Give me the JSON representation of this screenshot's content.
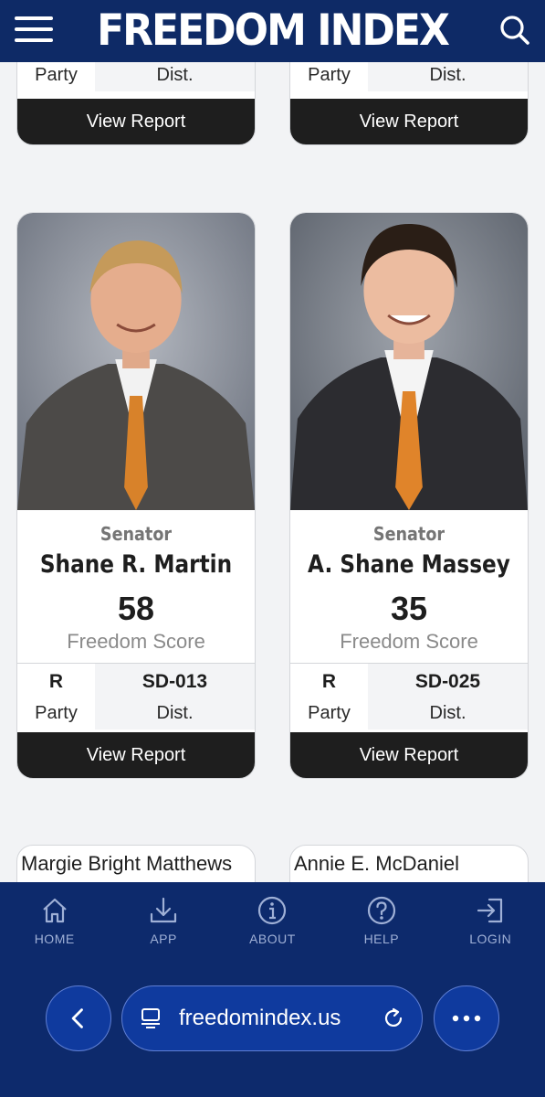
{
  "header": {
    "logo": "FREEDOM INDEX",
    "menu_icon": "hamburger-menu-icon",
    "search_icon": "search-icon"
  },
  "top_cards": [
    {
      "party_label": "Party",
      "district_label": "Dist.",
      "button": "View Report"
    },
    {
      "party_label": "Party",
      "district_label": "Dist.",
      "button": "View Report"
    }
  ],
  "cards": [
    {
      "role": "Senator",
      "name": "Shane R. Martin",
      "score": "58",
      "score_label": "Freedom Score",
      "party": "R",
      "party_label": "Party",
      "district": "SD-013",
      "district_label": "Dist.",
      "button": "View Report"
    },
    {
      "role": "Senator",
      "name": "A. Shane Massey",
      "score": "35",
      "score_label": "Freedom Score",
      "party": "R",
      "party_label": "Party",
      "district": "SD-025",
      "district_label": "Dist.",
      "button": "View Report"
    }
  ],
  "next_cards": [
    {
      "name": "Margie Bright Matthews"
    },
    {
      "name": "Annie E. McDaniel"
    }
  ],
  "bottom_nav": [
    {
      "label": "HOME",
      "icon": "home-icon"
    },
    {
      "label": "APP",
      "icon": "download-icon"
    },
    {
      "label": "ABOUT",
      "icon": "info-icon"
    },
    {
      "label": "HELP",
      "icon": "help-icon"
    },
    {
      "label": "LOGIN",
      "icon": "login-icon"
    }
  ],
  "browser": {
    "url": "freedomindex.us"
  },
  "colors": {
    "header_bg": "#0e2a66",
    "nav_bg": "#0d2a6c",
    "button_bg": "#1e1e1e",
    "browser_pill": "#0f3a9e"
  }
}
